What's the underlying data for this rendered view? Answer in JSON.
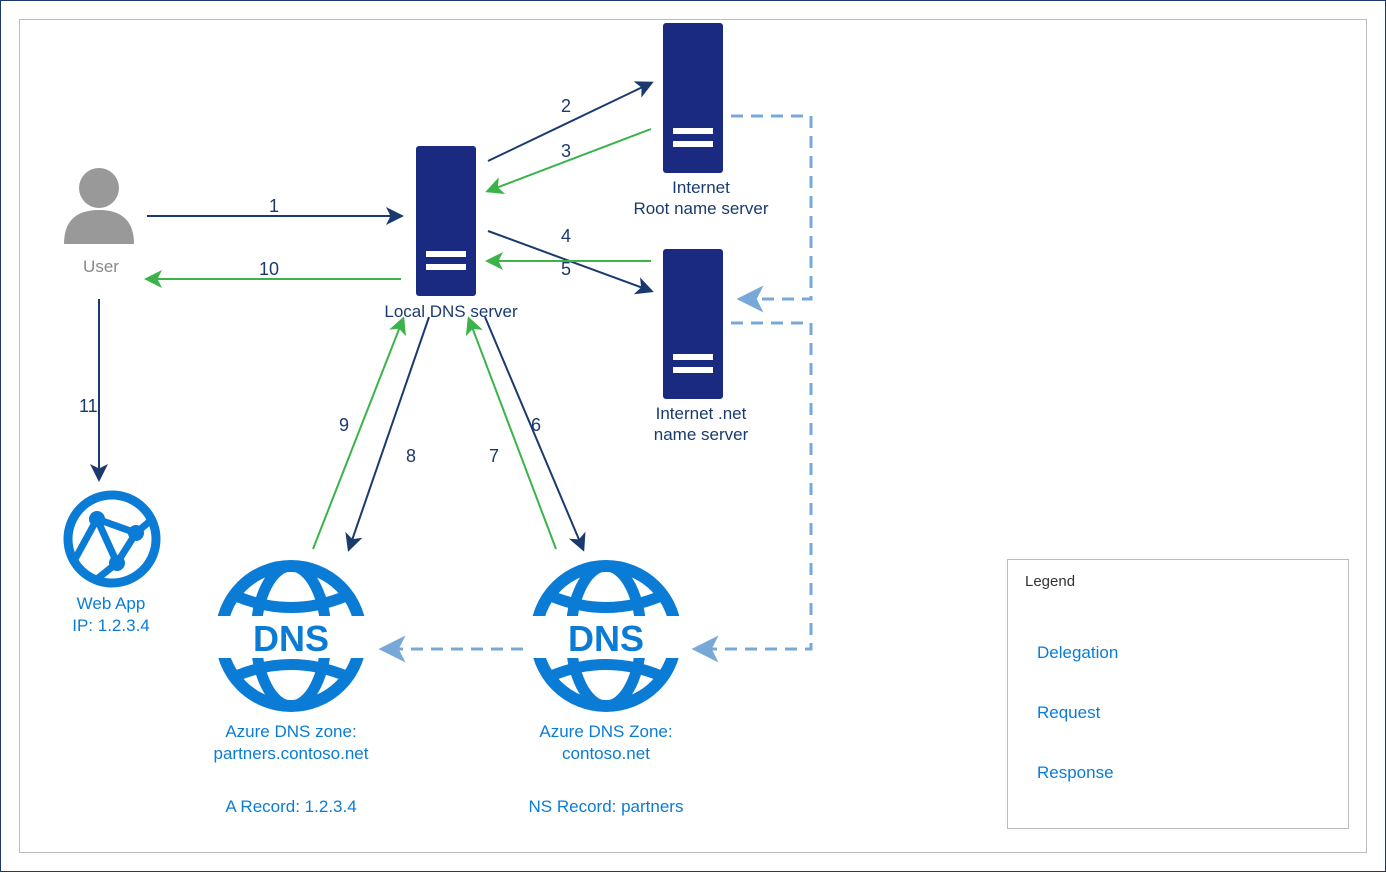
{
  "nodes": {
    "user": "User",
    "localdns": "Local DNS server",
    "root": "Internet\nRoot name server",
    "net": "Internet .net\nname server",
    "zone1_title": "Azure DNS zone:",
    "zone1_sub": "partners.contoso.net",
    "zone1_rec": "A Record: 1.2.3.4",
    "zone2_title": "Azure DNS Zone:",
    "zone2_sub": "contoso.net",
    "zone2_rec": "NS Record: partners",
    "webapp": "Web App",
    "webapp_ip": "IP: 1.2.3.4"
  },
  "steps": {
    "s1": "1",
    "s2": "2",
    "s3": "3",
    "s4": "4",
    "s5": "5",
    "s6": "6",
    "s7": "7",
    "s8": "8",
    "s9": "9",
    "s10": "10",
    "s11": "11"
  },
  "legend": {
    "title": "Legend",
    "delegation": "Delegation",
    "request": "Request",
    "response": "Response"
  }
}
